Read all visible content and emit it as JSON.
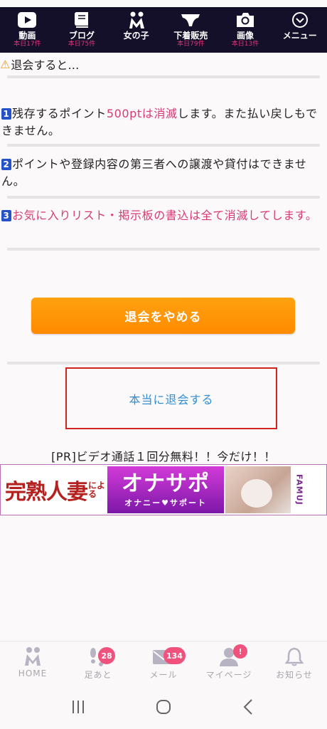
{
  "top_nav": [
    {
      "label": "動画",
      "sub": "本日17件"
    },
    {
      "label": "ブログ",
      "sub": "本日75件"
    },
    {
      "label": "女の子",
      "sub": ""
    },
    {
      "label": "下着販売",
      "sub": "本日79件"
    },
    {
      "label": "画像",
      "sub": "本日13件"
    },
    {
      "label": "メニュー",
      "sub": ""
    }
  ],
  "intro": {
    "warn_glyph": "⚠",
    "text": "退会すると…"
  },
  "items": [
    {
      "num": "1",
      "pre": "残存するポイント",
      "highlight": "500ptは消滅",
      "post": "します。また払い戻しもできません。"
    },
    {
      "num": "2",
      "text": "ポイントや登録内容の第三者への譲渡や貸付はできません。"
    },
    {
      "num": "3",
      "text": "お気に入りリスト・掲示板の書込は全て消滅してします。"
    }
  ],
  "buttons": {
    "stop_label": "退会をやめる",
    "quit_label": "本当に退会する"
  },
  "pr": {
    "text": "[PR]ビデオ通話１回分無料！！今だけ！！",
    "banner_left": "完熟人妻",
    "banner_by_1": "によ",
    "banner_by_2": "る",
    "banner_title": "オナサポ",
    "banner_subtitle": "オナニー♥サポート",
    "banner_logo": "FAMUJ"
  },
  "bottom_tabs": [
    {
      "label": "HOME",
      "badge": "",
      "icon": "home-logo-icon"
    },
    {
      "label": "足あと",
      "badge": "28",
      "icon": "footprints-icon"
    },
    {
      "label": "メール",
      "badge": "134",
      "icon": "mail-icon"
    },
    {
      "label": "マイページ",
      "badge": "!",
      "icon": "profile-icon"
    },
    {
      "label": "お知らせ",
      "badge": "",
      "icon": "bell-icon"
    }
  ],
  "colors": {
    "nav_bg": "#15102a",
    "accent_pink": "#d83a74",
    "button_orange": "#ff9a0a",
    "quit_border": "#d0241f",
    "link_blue": "#2f8ed3"
  }
}
